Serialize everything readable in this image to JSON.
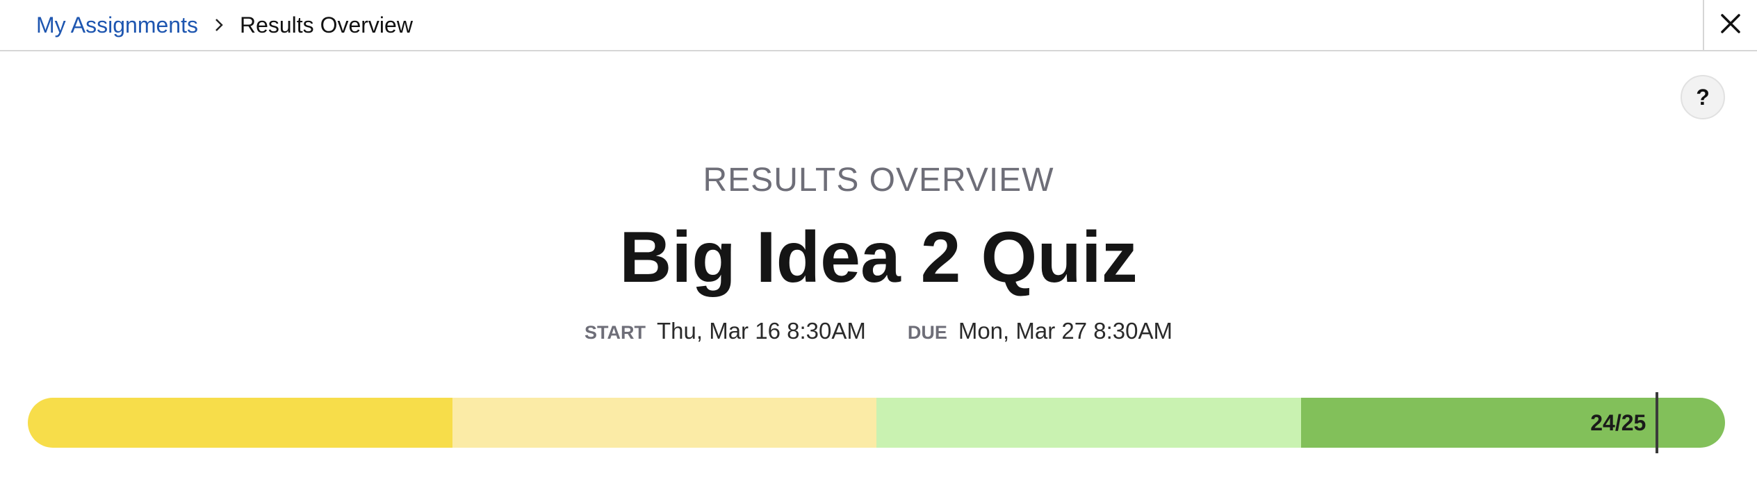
{
  "breadcrumb": {
    "parent_label": "My Assignments",
    "current_label": "Results Overview"
  },
  "header": {
    "close_icon": "close-icon",
    "help_label": "?"
  },
  "overview": {
    "eyebrow": "RESULTS OVERVIEW",
    "title": "Big Idea 2 Quiz",
    "start_label": "START",
    "start_value": "Thu, Mar 16 8:30AM",
    "due_label": "DUE",
    "due_value": "Mon, Mar 27 8:30AM"
  },
  "score": {
    "label": "24/25",
    "earned": 24,
    "possible": 25,
    "segment_colors": [
      "#f7dd4a",
      "#fbeba6",
      "#c9f2b1",
      "#82c05a"
    ]
  },
  "colors": {
    "link": "#1e56b0",
    "muted": "#6e6e78"
  }
}
